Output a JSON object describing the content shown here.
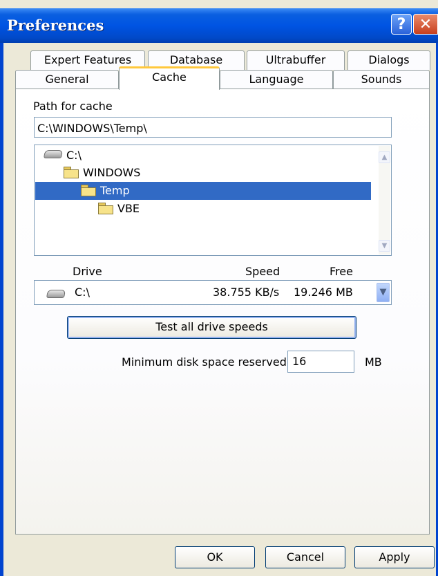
{
  "window": {
    "title": "Preferences"
  },
  "tabs_top": [
    "Expert Features",
    "Database",
    "Ultrabuffer",
    "Dialogs"
  ],
  "tabs_bottom": [
    "General",
    "Cache",
    "Language",
    "Sounds"
  ],
  "active_tab": "Cache",
  "cache": {
    "path_label": "Path for cache",
    "path_value": "C:\\WINDOWS\\Temp\\",
    "tree": [
      {
        "label": "C:\\",
        "icon": "drive-icon",
        "selected": false
      },
      {
        "label": "WINDOWS",
        "icon": "folder-icon",
        "selected": false
      },
      {
        "label": "Temp",
        "icon": "folder-icon",
        "selected": true
      },
      {
        "label": "VBE",
        "icon": "folder-icon",
        "selected": false
      }
    ],
    "drive_columns": {
      "drive": "Drive",
      "speed": "Speed",
      "free": "Free"
    },
    "drive_selected": {
      "drive": "C:\\",
      "speed": "38.755 KB/s",
      "free": "19.246 MB"
    },
    "test_button": "Test all drive speeds",
    "min_space_label": "Minimum disk space reserved:",
    "min_space_value": "16",
    "min_space_unit": "MB"
  },
  "buttons": {
    "ok": "OK",
    "cancel": "Cancel",
    "apply": "Apply"
  },
  "colors": {
    "selection": "#316ac5",
    "active_tab_accent": "#ffc83c",
    "titlebar": "#0054e3"
  }
}
